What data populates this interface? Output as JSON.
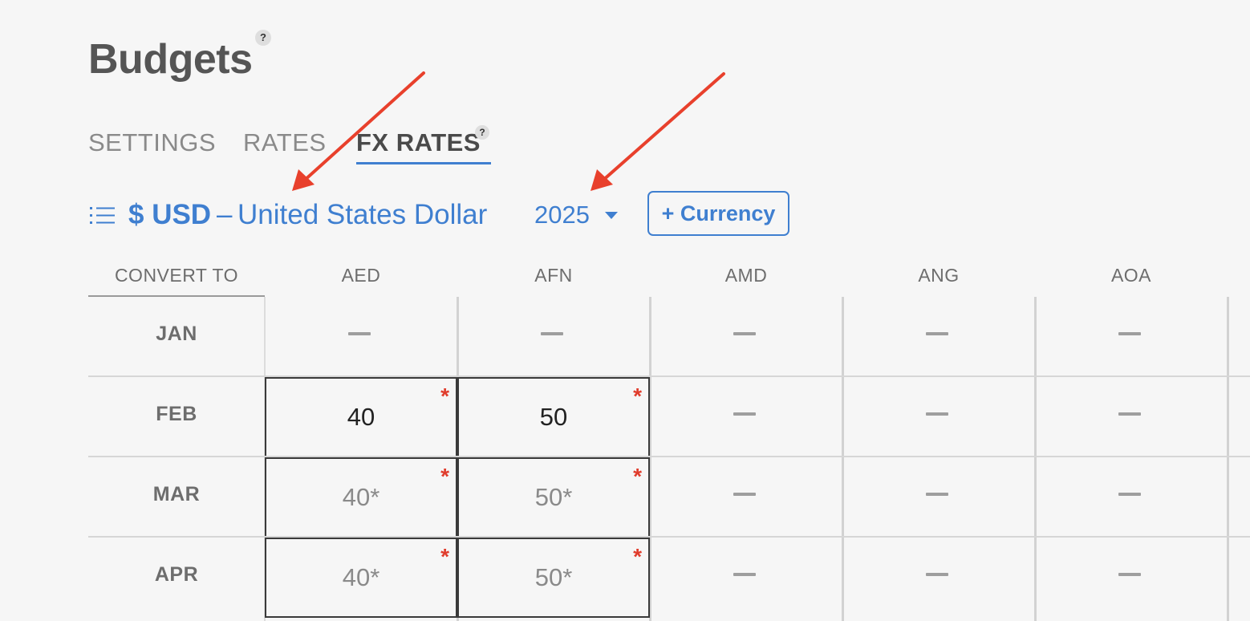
{
  "page": {
    "title": "Budgets",
    "help_glyph": "?"
  },
  "tabs": [
    {
      "label": "SETTINGS",
      "active": false
    },
    {
      "label": "RATES",
      "active": false
    },
    {
      "label": "FX RATES",
      "active": true
    }
  ],
  "base_currency": {
    "icon": "list-icon",
    "symbol_code": "$ USD",
    "separator": "–",
    "name": "United States Dollar"
  },
  "year_select": {
    "value": "2025",
    "icon": "caret-down-icon"
  },
  "add_currency_button": {
    "label": "+ Currency"
  },
  "table": {
    "first_header": "CONVERT TO",
    "currencies": [
      "AED",
      "AFN",
      "AMD",
      "ANG",
      "AOA"
    ],
    "months": [
      "JAN",
      "FEB",
      "MAR",
      "APR"
    ],
    "required_marker": "*",
    "rows": [
      {
        "AED": "",
        "AFN": "",
        "AMD": "",
        "ANG": "",
        "AOA": ""
      },
      {
        "AED": "40",
        "AFN": "50",
        "AMD": "",
        "ANG": "",
        "AOA": ""
      },
      {
        "AED": "40*",
        "AFN": "50*",
        "AMD": "",
        "ANG": "",
        "AOA": ""
      },
      {
        "AED": "40*",
        "AFN": "50*",
        "AMD": "",
        "ANG": "",
        "AOA": ""
      }
    ]
  },
  "colors": {
    "accent": "#3f7fd0",
    "annotation_arrow": "#e8402c",
    "required": "#e03c2c",
    "background": "#f6f6f6"
  }
}
